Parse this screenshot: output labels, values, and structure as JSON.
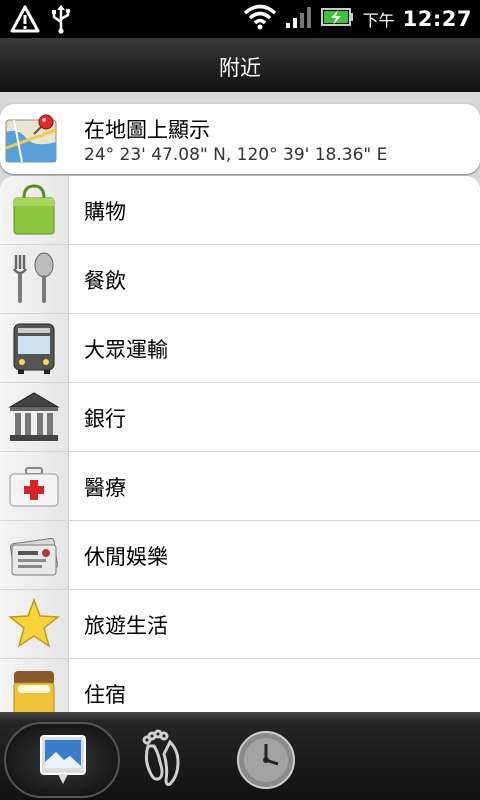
{
  "status_bar": {
    "icons": [
      "warning-icon",
      "usb-icon",
      "wifi-icon",
      "signal-icon",
      "battery-charging-icon"
    ],
    "ampm": "下午",
    "time": "12:27"
  },
  "header": {
    "title": "附近"
  },
  "map_entry": {
    "label": "在地圖上顯示",
    "coordinates": "24° 23' 47.08\" N, 120° 39' 18.36\" E",
    "icon": "map-pin-icon"
  },
  "categories": [
    {
      "label": "購物",
      "icon": "shopping-bag-icon"
    },
    {
      "label": "餐飲",
      "icon": "fork-spoon-icon"
    },
    {
      "label": "大眾運輸",
      "icon": "bus-icon"
    },
    {
      "label": "銀行",
      "icon": "bank-icon"
    },
    {
      "label": "醫療",
      "icon": "medical-kit-icon"
    },
    {
      "label": "休閒娛樂",
      "icon": "tickets-icon"
    },
    {
      "label": "旅遊生活",
      "icon": "star-icon"
    },
    {
      "label": "住宿",
      "icon": "bed-icon"
    }
  ],
  "bottom_tabs": [
    {
      "name": "nearby",
      "icon": "location-photo-icon",
      "selected": true
    },
    {
      "name": "footprints",
      "icon": "footprints-icon",
      "selected": false
    },
    {
      "name": "history",
      "icon": "clock-icon",
      "selected": false
    }
  ]
}
